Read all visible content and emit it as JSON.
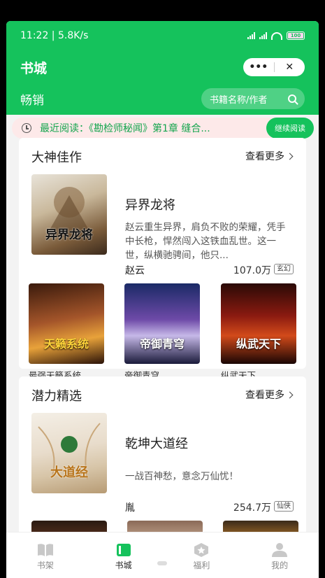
{
  "status": {
    "time_speed": "11:22 | 5.8K/s",
    "battery": "100"
  },
  "header": {
    "title": "书城",
    "capsule_more": "•••",
    "capsule_close": "✕",
    "section_tab": "畅销",
    "search_placeholder": "书籍名称/作者"
  },
  "recent": {
    "text": "最近阅读：《勘检师秘闻》第1章 缝合...",
    "continue_label": "继续阅读"
  },
  "sections": [
    {
      "title": "大神佳作",
      "more_label": "查看更多",
      "featured": {
        "title": "异界龙将",
        "desc": "赵云重生异界，肩负不败的荣耀，凭手中长枪，悍然闯入这铁血乱世。这一世，纵横驰骋间，他只...",
        "author": "赵云",
        "count": "107.0万",
        "tag": "玄幻",
        "cover_text": "异界龙将"
      },
      "grid": [
        {
          "name": "最强天籁系统",
          "cover_text": "天籁系统"
        },
        {
          "name": "帝御青穹",
          "cover_text": "帝御青穹"
        },
        {
          "name": "纵武天下",
          "cover_text": "纵武天下"
        }
      ]
    },
    {
      "title": "潜力精选",
      "more_label": "查看更多",
      "featured": {
        "title": "乾坤大道经",
        "desc": "一战百神愁，意念万仙忧！",
        "author": "胤",
        "count": "254.7万",
        "tag": "仙侠",
        "cover_text": "大道经"
      }
    }
  ],
  "tabbar": {
    "items": [
      {
        "label": "书架",
        "icon": "book-open-icon"
      },
      {
        "label": "书城",
        "icon": "store-icon"
      },
      {
        "label": "福利",
        "icon": "star-badge-icon"
      },
      {
        "label": "我的",
        "icon": "user-icon"
      }
    ]
  },
  "colors": {
    "accent": "#15c25c",
    "recent_bg": "#fde9e9"
  }
}
